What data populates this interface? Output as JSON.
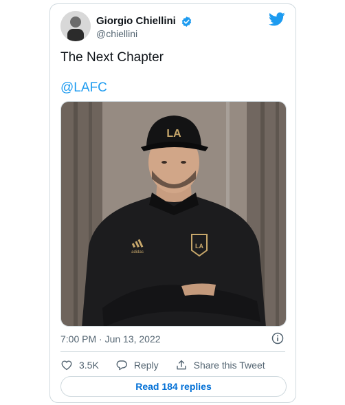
{
  "tweet": {
    "display_name": "Giorgio Chiellini",
    "handle": "@chiellini",
    "text": "The Next Chapter",
    "mention": "@LAFC",
    "timestamp": "7:00 PM · Jun 13, 2022",
    "icons": {
      "avatar": "avatar",
      "verified": "verified-badge-icon",
      "brand": "twitter-bird-icon",
      "info": "info-icon"
    },
    "media": {
      "cap_logo": "LA",
      "crest_logo": "LA",
      "brand_text": "adidas"
    },
    "actions": {
      "like_count": "3.5K",
      "reply_label": "Reply",
      "share_label": "Share this Tweet"
    },
    "read_replies_label": "Read 184 replies"
  },
  "colors": {
    "accent": "#1d9bf0",
    "link_button": "#006fd6",
    "muted_text": "#536471",
    "border": "#cfd9de"
  }
}
